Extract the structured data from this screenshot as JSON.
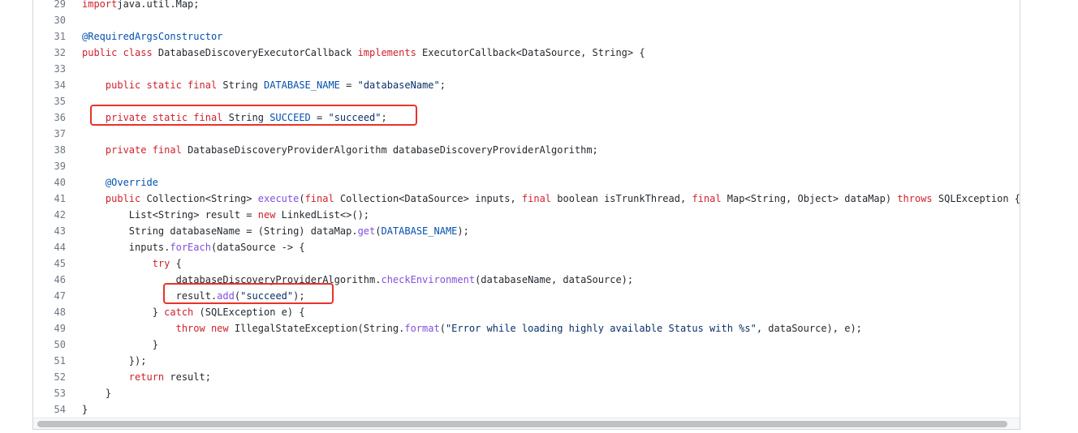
{
  "lines": [
    {
      "num": "29",
      "tokens": [
        [
          "kw",
          "import"
        ],
        [
          "",
          "java.util.Map;"
        ]
      ]
    },
    {
      "num": "30",
      "tokens": []
    },
    {
      "num": "31",
      "tokens": [
        [
          "an",
          "@RequiredArgsConstructor"
        ]
      ]
    },
    {
      "num": "32",
      "tokens": [
        [
          "kw",
          "public class "
        ],
        [
          "",
          "DatabaseDiscoveryExecutorCallback "
        ],
        [
          "kw",
          "implements "
        ],
        [
          "",
          "ExecutorCallback<DataSource, String> {"
        ]
      ]
    },
    {
      "num": "33",
      "tokens": []
    },
    {
      "num": "34",
      "tokens": [
        [
          "",
          "    "
        ],
        [
          "kw",
          "public static final "
        ],
        [
          "",
          "String "
        ],
        [
          "cn",
          "DATABASE_NAME"
        ],
        [
          "",
          " = "
        ],
        [
          "st",
          "\"databaseName\""
        ],
        [
          "",
          ";"
        ]
      ]
    },
    {
      "num": "35",
      "tokens": []
    },
    {
      "num": "36",
      "tokens": [
        [
          "",
          "    "
        ],
        [
          "kw",
          "private static final "
        ],
        [
          "",
          "String "
        ],
        [
          "cn",
          "SUCCEED"
        ],
        [
          "",
          " = "
        ],
        [
          "st",
          "\"succeed\""
        ],
        [
          "",
          ";"
        ]
      ]
    },
    {
      "num": "37",
      "tokens": []
    },
    {
      "num": "38",
      "tokens": [
        [
          "",
          "    "
        ],
        [
          "kw",
          "private final "
        ],
        [
          "",
          "DatabaseDiscoveryProviderAlgorithm databaseDiscoveryProviderAlgorithm;"
        ]
      ]
    },
    {
      "num": "39",
      "tokens": []
    },
    {
      "num": "40",
      "tokens": [
        [
          "",
          "    "
        ],
        [
          "an",
          "@Override"
        ]
      ]
    },
    {
      "num": "41",
      "tokens": [
        [
          "",
          "    "
        ],
        [
          "kw",
          "public "
        ],
        [
          "",
          "Collection<String> "
        ],
        [
          "fn",
          "execute"
        ],
        [
          "",
          "("
        ],
        [
          "kw",
          "final "
        ],
        [
          "",
          "Collection<DataSource> inputs, "
        ],
        [
          "kw",
          "final "
        ],
        [
          "",
          "boolean isTrunkThread, "
        ],
        [
          "kw",
          "final "
        ],
        [
          "",
          "Map<String, Object> dataMap) "
        ],
        [
          "kw",
          "throws "
        ],
        [
          "",
          "SQLException {"
        ]
      ]
    },
    {
      "num": "42",
      "tokens": [
        [
          "",
          "        List<String> result = "
        ],
        [
          "kw",
          "new "
        ],
        [
          "",
          "LinkedList<>();"
        ]
      ]
    },
    {
      "num": "43",
      "tokens": [
        [
          "",
          "        String databaseName = (String) dataMap."
        ],
        [
          "fn",
          "get"
        ],
        [
          "",
          "("
        ],
        [
          "cn",
          "DATABASE_NAME"
        ],
        [
          "",
          ");"
        ]
      ]
    },
    {
      "num": "44",
      "tokens": [
        [
          "",
          "        inputs."
        ],
        [
          "fn",
          "forEach"
        ],
        [
          "",
          "(dataSource -> {"
        ]
      ]
    },
    {
      "num": "45",
      "tokens": [
        [
          "",
          "            "
        ],
        [
          "kw",
          "try "
        ],
        [
          "",
          "{"
        ]
      ]
    },
    {
      "num": "46",
      "tokens": [
        [
          "",
          "                databaseDiscoveryProviderAlgorithm."
        ],
        [
          "fn",
          "checkEnvironment"
        ],
        [
          "",
          "(databaseName, dataSource);"
        ]
      ]
    },
    {
      "num": "47",
      "tokens": [
        [
          "",
          "                result."
        ],
        [
          "fn",
          "add"
        ],
        [
          "",
          "("
        ],
        [
          "st",
          "\"succeed\""
        ],
        [
          "",
          ");"
        ]
      ]
    },
    {
      "num": "48",
      "tokens": [
        [
          "",
          "            } "
        ],
        [
          "kw",
          "catch "
        ],
        [
          "",
          "(SQLException e) {"
        ]
      ]
    },
    {
      "num": "49",
      "tokens": [
        [
          "",
          "                "
        ],
        [
          "kw",
          "throw new "
        ],
        [
          "",
          "IllegalStateException(String."
        ],
        [
          "fn",
          "format"
        ],
        [
          "",
          "("
        ],
        [
          "st",
          "\"Error while loading highly available Status with %s\""
        ],
        [
          "",
          ", dataSource), e);"
        ]
      ]
    },
    {
      "num": "50",
      "tokens": [
        [
          "",
          "            }"
        ]
      ]
    },
    {
      "num": "51",
      "tokens": [
        [
          "",
          "        });"
        ]
      ]
    },
    {
      "num": "52",
      "tokens": [
        [
          "",
          "        "
        ],
        [
          "kw",
          "return "
        ],
        [
          "",
          "result;"
        ]
      ]
    },
    {
      "num": "53",
      "tokens": [
        [
          "",
          "    }"
        ]
      ]
    },
    {
      "num": "54",
      "tokens": [
        [
          "",
          "}"
        ]
      ]
    }
  ],
  "highlights": [
    "36",
    "47"
  ],
  "colors": {
    "keyword": "#cf222e",
    "function": "#8250df",
    "string": "#0a3069",
    "annotation": "#0550ae",
    "highlight_box": "#e8332a"
  }
}
